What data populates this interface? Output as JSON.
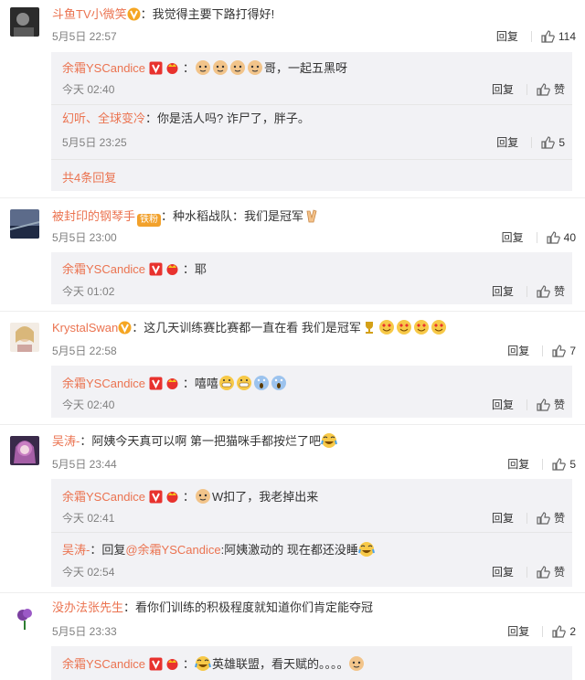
{
  "ui": {
    "reply_label": "回复",
    "like_label": "赞",
    "replies_more": "共4条回复"
  },
  "comments": [
    {
      "user": "斗鱼TV小微笑",
      "text": "：我觉得主要下路打得好!",
      "time": "5月5日 22:57",
      "likes": "114",
      "replies": [
        {
          "user": "余霜YSCandice",
          "text": "哥，一起五黑呀",
          "time": "今天 02:40",
          "likes": "赞"
        },
        {
          "user": "幻听、全球变冷",
          "text": "：你是活人吗? 诈尸了，胖子。",
          "time": "5月5日 23:25",
          "likes": "5"
        }
      ]
    },
    {
      "user": "被封印的钢琴手",
      "fan_badge": "铁粉",
      "text": "：种水稻战队：我们是冠军",
      "time": "5月5日 23:00",
      "likes": "40",
      "replies": [
        {
          "user": "余霜YSCandice",
          "text": "：耶",
          "time": "今天 01:02",
          "likes": "赞"
        }
      ]
    },
    {
      "user": "KrystalSwan",
      "text": "：这几天训练赛比赛都一直在看 我们是冠军",
      "time": "5月5日 22:58",
      "likes": "7",
      "replies": [
        {
          "user": "余霜YSCandice",
          "text": "：嘻嘻",
          "time": "今天 02:40",
          "likes": "赞"
        }
      ]
    },
    {
      "user": "吴涛-",
      "text": "：阿姨今天真可以啊 第一把猫咪手都按烂了吧",
      "time": "5月5日 23:44",
      "likes": "5",
      "replies": [
        {
          "user": "余霜YSCandice",
          "text": "W扣了，我老掉出来",
          "time": "今天 02:41",
          "likes": "赞"
        },
        {
          "user": "吴涛-",
          "text": "：回复",
          "mention": "@余霜YSCandice",
          "text2": ":阿姨激动的 现在都还没睡",
          "time": "今天 02:54",
          "likes": "赞"
        }
      ]
    },
    {
      "user": "没办法张先生",
      "text": "：看你们训练的积极程度就知道你们肯定能夺冠",
      "time": "5月5日 23:33",
      "likes": "2",
      "replies": [
        {
          "user": "余霜YSCandice",
          "text": "英雄联盟，看天赋的。。。。",
          "time": "",
          "likes": ""
        }
      ]
    }
  ],
  "colors": {
    "username": "#eb7350",
    "reply_bg": "#f2f2f5",
    "text": "#333333",
    "time": "#808080"
  }
}
